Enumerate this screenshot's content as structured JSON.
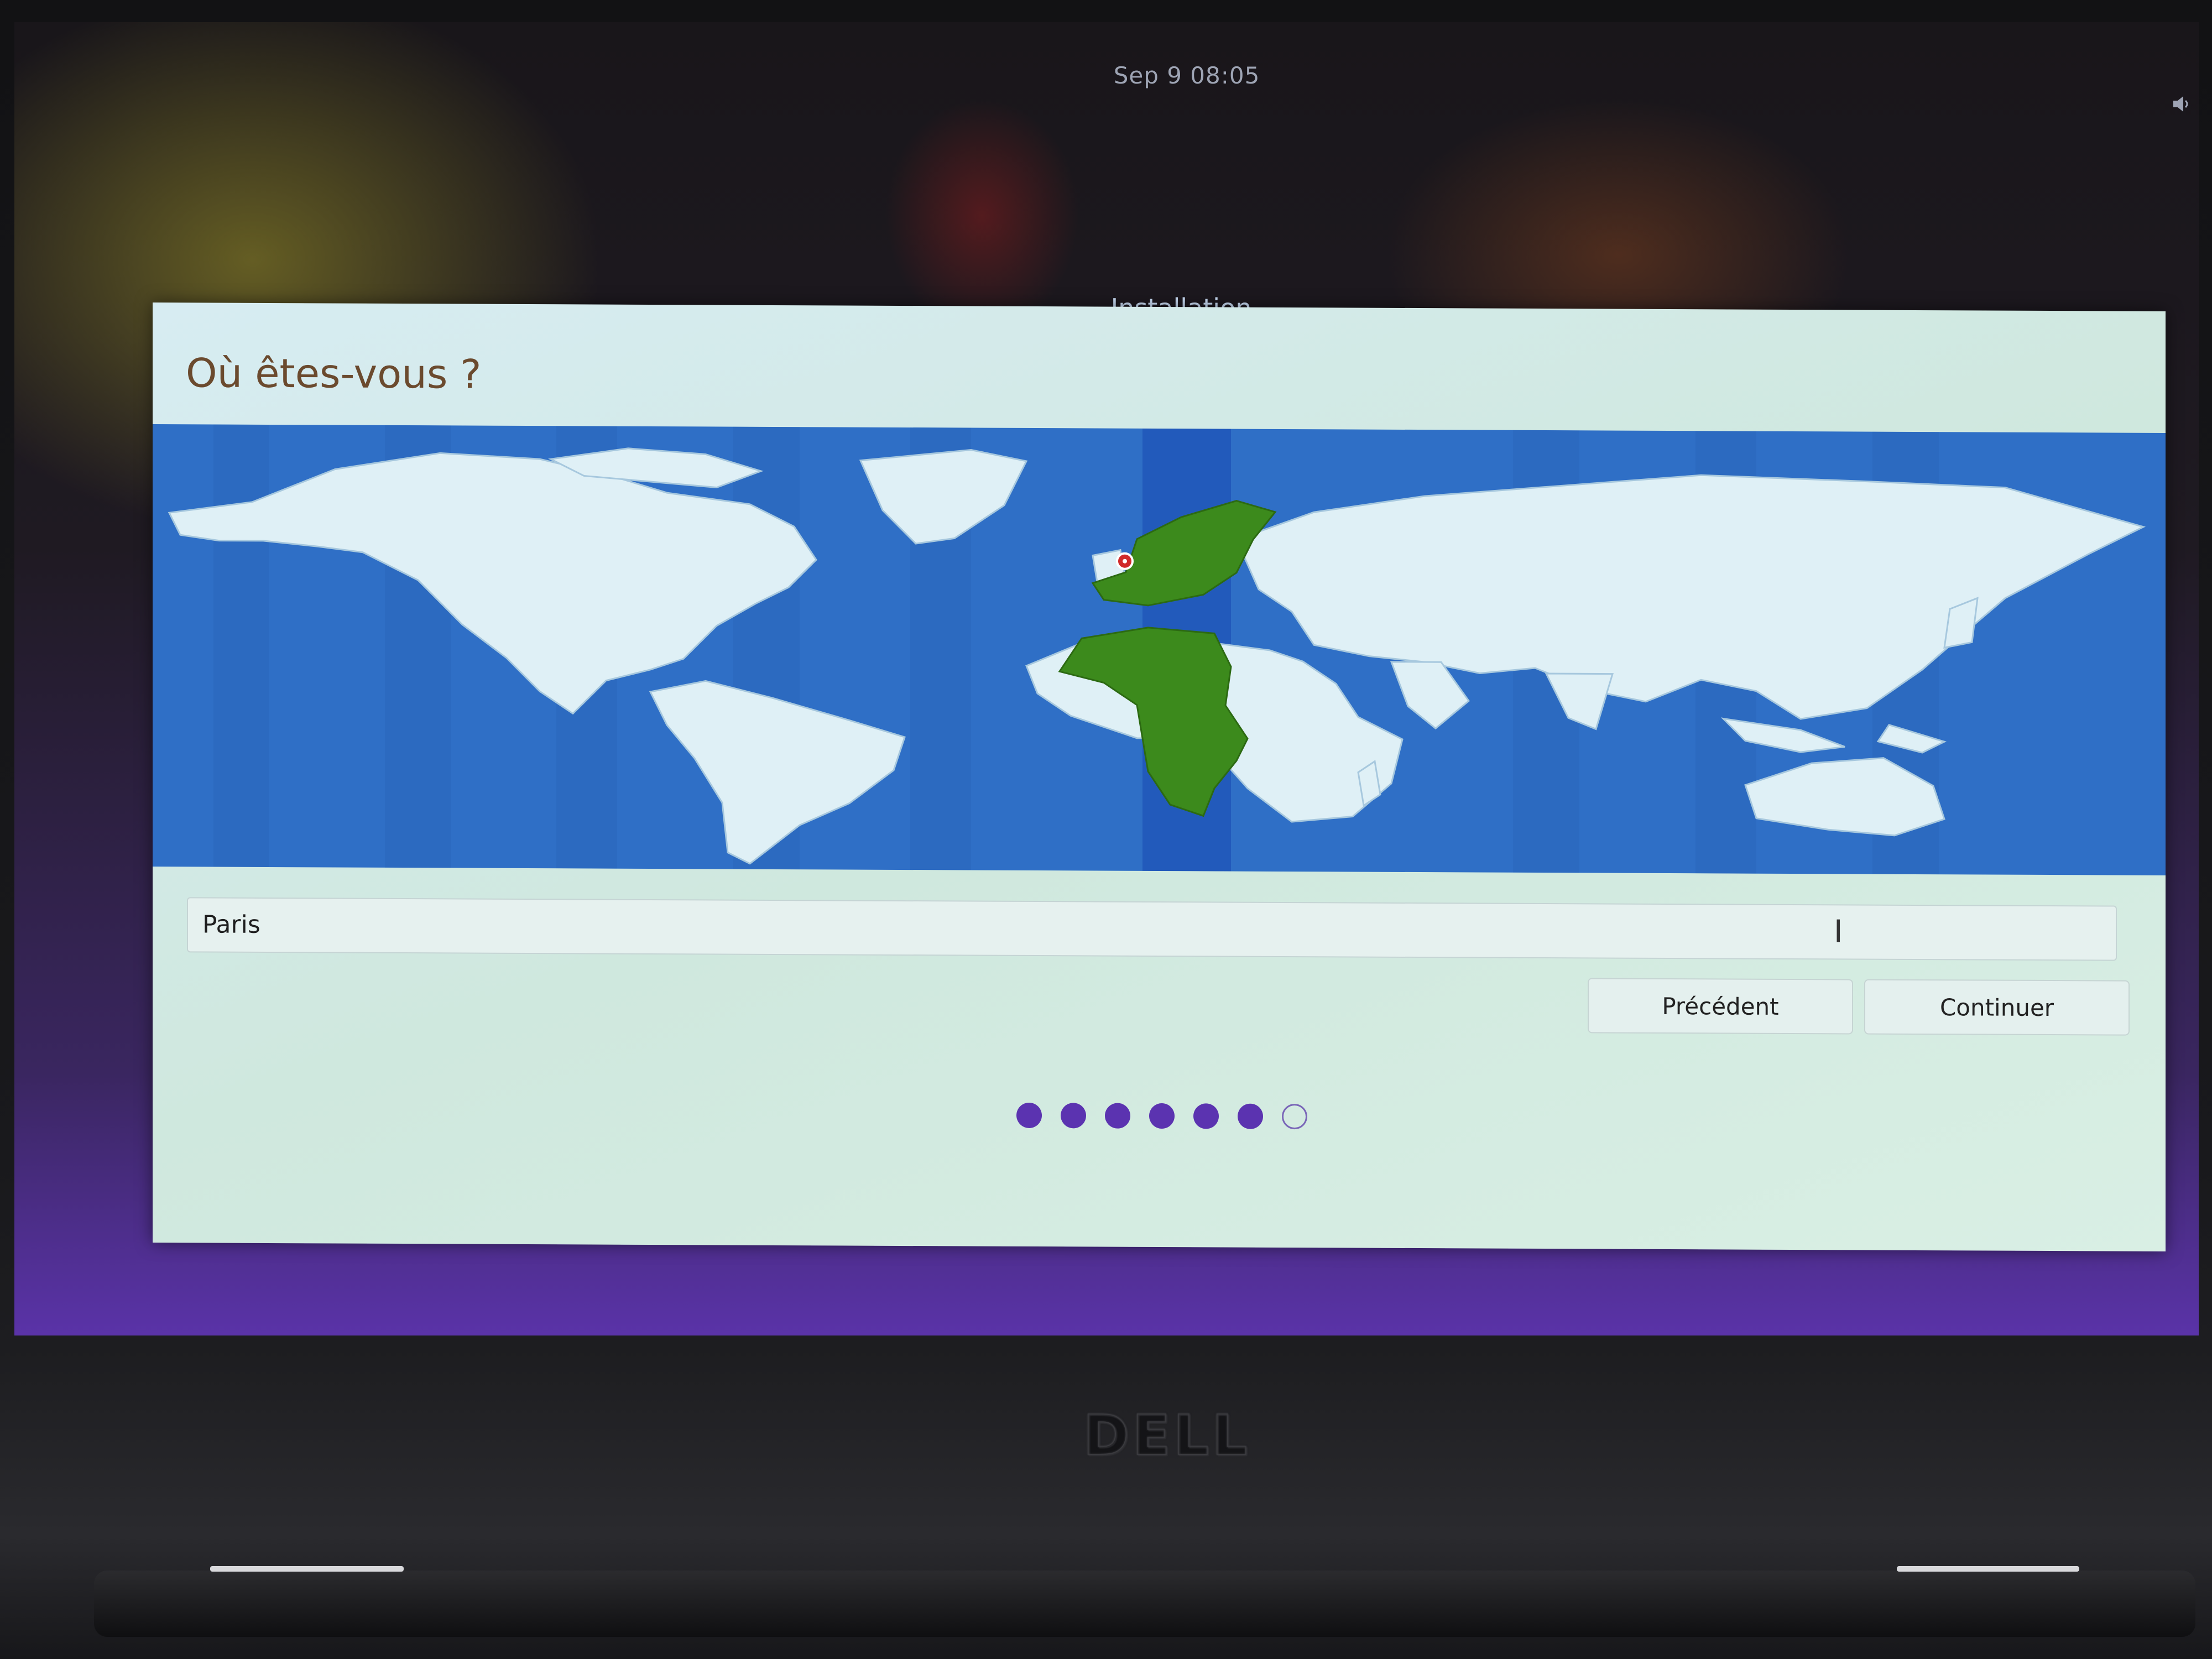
{
  "system": {
    "clock": "Sep 9  08:05"
  },
  "window": {
    "title": "Installation"
  },
  "page": {
    "heading": "Où êtes-vous ?"
  },
  "map": {
    "selected_city": "Paris"
  },
  "timezone_input": {
    "value": "Paris"
  },
  "buttons": {
    "back_label": "Précédent",
    "continue_label": "Continuer"
  },
  "progress": {
    "current_step": 6,
    "total_steps": 7
  },
  "colors": {
    "ocean": "#2f6fc6",
    "land": "#dff0f6",
    "selected_zone": "#3c8a1c",
    "progress_dot": "#5b33b0",
    "heading": "#6b4a2e"
  },
  "bezel": {
    "brand": "DELL"
  }
}
